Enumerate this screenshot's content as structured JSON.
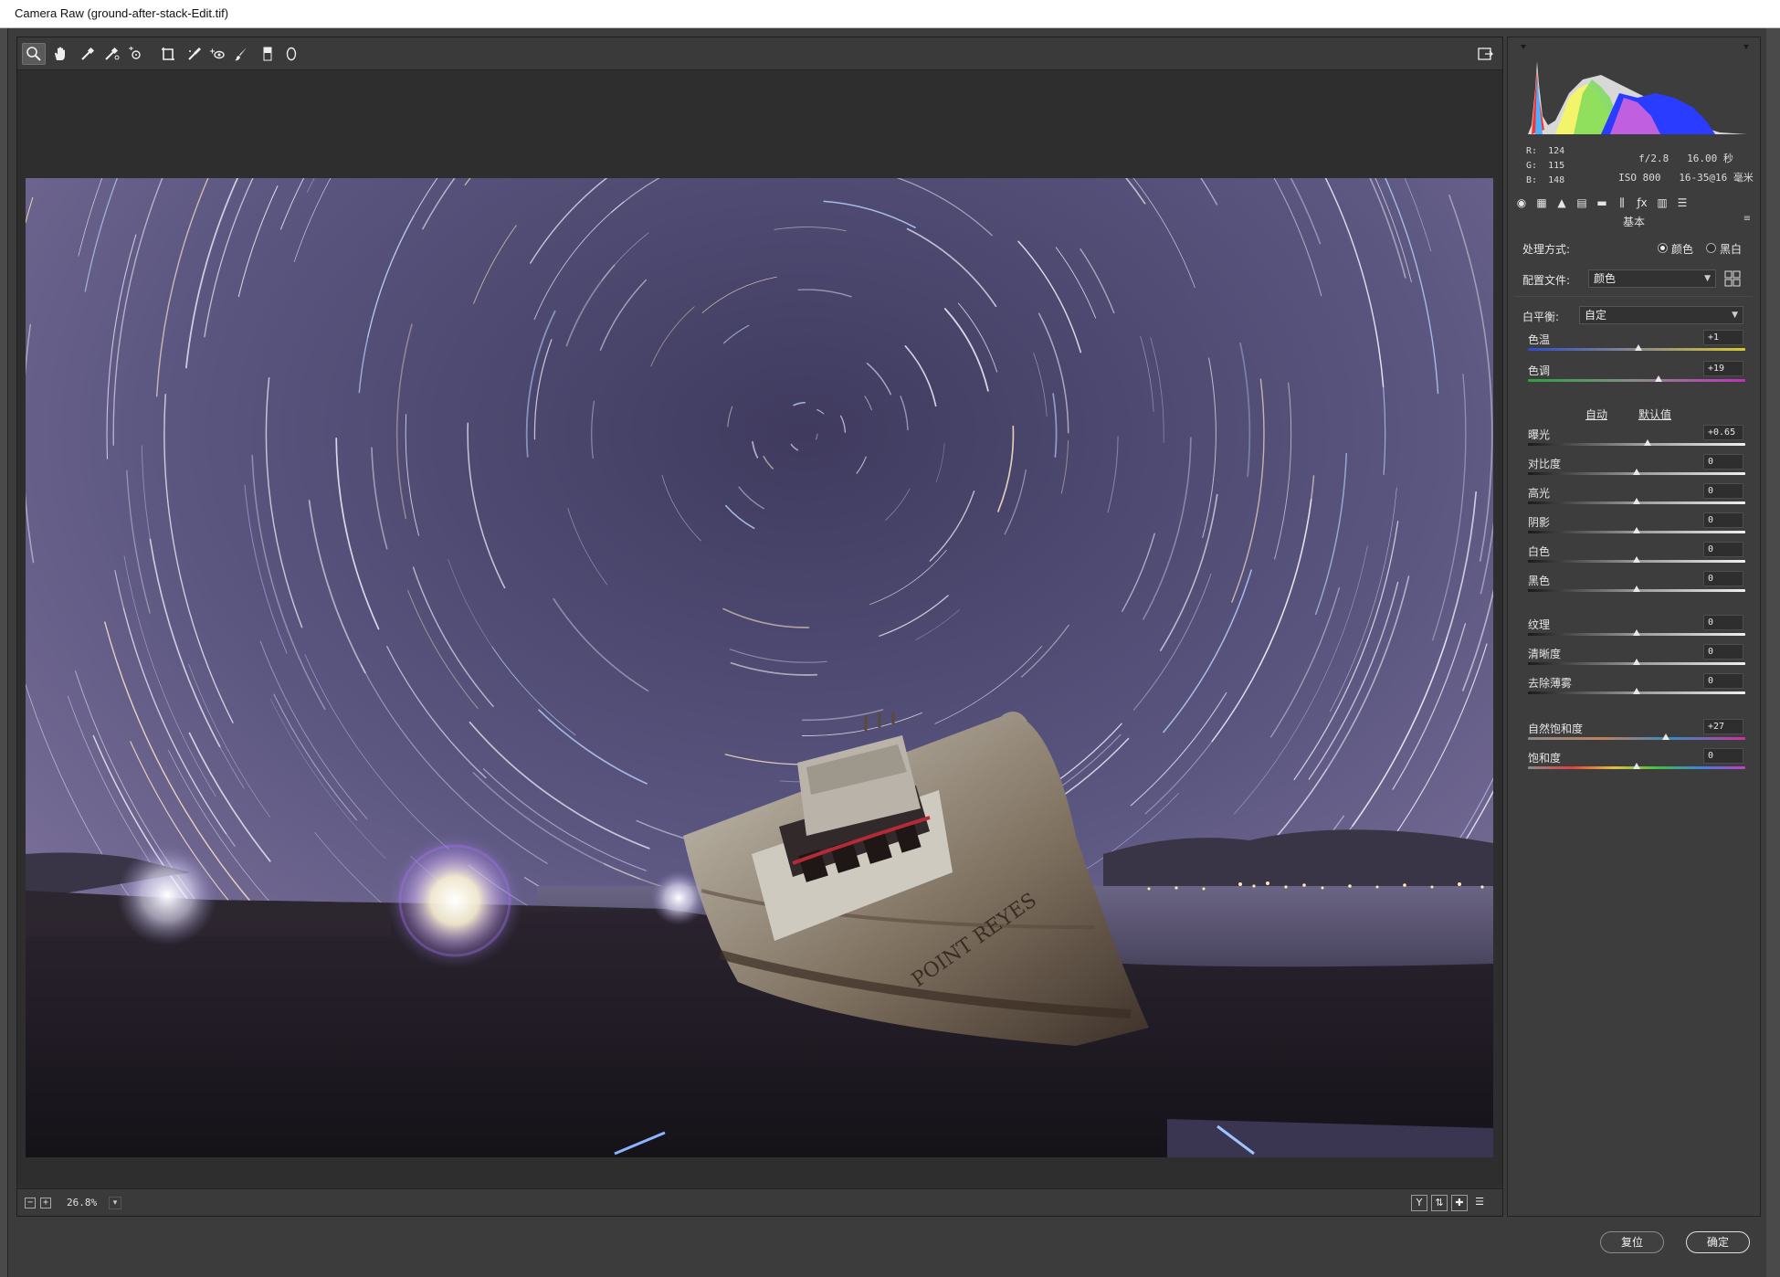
{
  "window": {
    "title": "Camera Raw (ground-after-stack-Edit.tif)"
  },
  "toolbar": {
    "tools": [
      "zoom-icon",
      "hand-icon",
      "white-balance-icon",
      "color-sampler-icon",
      "targeted-adjust-icon",
      "transform-icon",
      "spot-removal-icon",
      "red-eye-icon",
      "adjustment-brush-icon",
      "graduated-filter-icon",
      "radial-filter-icon"
    ],
    "open_preferences": "open-panel-icon"
  },
  "status": {
    "zoom": "26.8%"
  },
  "readout": {
    "r_label": "R:",
    "r": "124",
    "g_label": "G:",
    "g": "115",
    "b_label": "B:",
    "b": "148"
  },
  "camera": {
    "aperture": "f/2.8",
    "shutter": "16.00 秒",
    "iso": "ISO 800",
    "lens": "16-35@16 毫米"
  },
  "panel": {
    "title": "基本",
    "treatment_label": "处理方式:",
    "treatment_color": "颜色",
    "treatment_bw": "黑白",
    "profile_label": "配置文件:",
    "profile_value": "颜色",
    "wb_label": "白平衡:",
    "wb_value": "自定",
    "auto": "自动",
    "default": "默认值",
    "sliders": [
      {
        "name": "色温",
        "value": "+1",
        "pos": 0.51
      },
      {
        "name": "色调",
        "value": "+19",
        "pos": 0.6
      },
      {
        "name": "曝光",
        "value": "+0.65",
        "pos": 0.55
      },
      {
        "name": "对比度",
        "value": "0",
        "pos": 0.5
      },
      {
        "name": "高光",
        "value": "0",
        "pos": 0.5
      },
      {
        "name": "阴影",
        "value": "0",
        "pos": 0.5
      },
      {
        "name": "白色",
        "value": "0",
        "pos": 0.5
      },
      {
        "name": "黑色",
        "value": "0",
        "pos": 0.5
      },
      {
        "name": "纹理",
        "value": "0",
        "pos": 0.5
      },
      {
        "name": "清晰度",
        "value": "0",
        "pos": 0.5
      },
      {
        "name": "去除薄雾",
        "value": "0",
        "pos": 0.5
      },
      {
        "name": "自然饱和度",
        "value": "+27",
        "pos": 0.635
      },
      {
        "name": "饱和度",
        "value": "0",
        "pos": 0.5
      }
    ]
  },
  "footer": {
    "reset": "复位",
    "ok": "确定"
  },
  "photo": {
    "boat_text": "POINT REYES"
  }
}
